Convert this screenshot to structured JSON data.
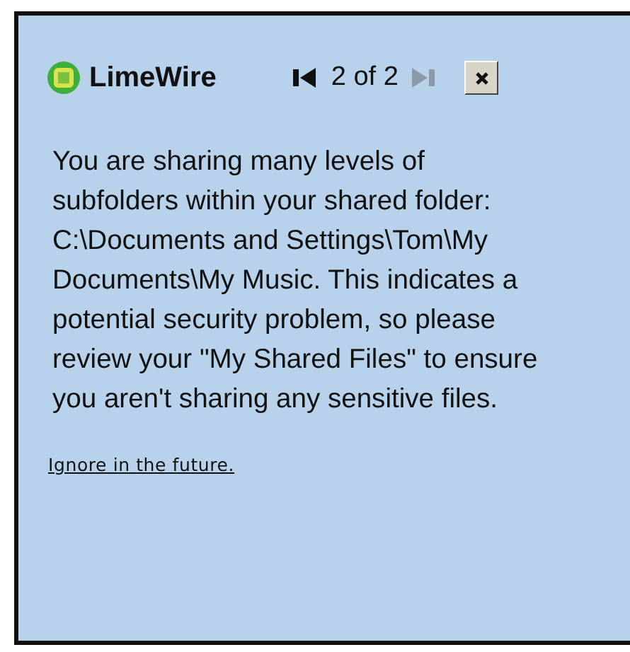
{
  "notification": {
    "title": "LimeWire",
    "pager": {
      "text": "2 of 2",
      "previous": {
        "disabled": false
      },
      "next": {
        "disabled": true
      }
    },
    "message": "You are sharing many levels of subfolders within your shared folder: C:\\Documents and Settings\\Tom\\My Documents\\My Music. This indicates a potential security problem, so please review your \"My Shared Files\" to ensure you aren't sharing any sensitive files.",
    "link": "Ignore in the future."
  }
}
